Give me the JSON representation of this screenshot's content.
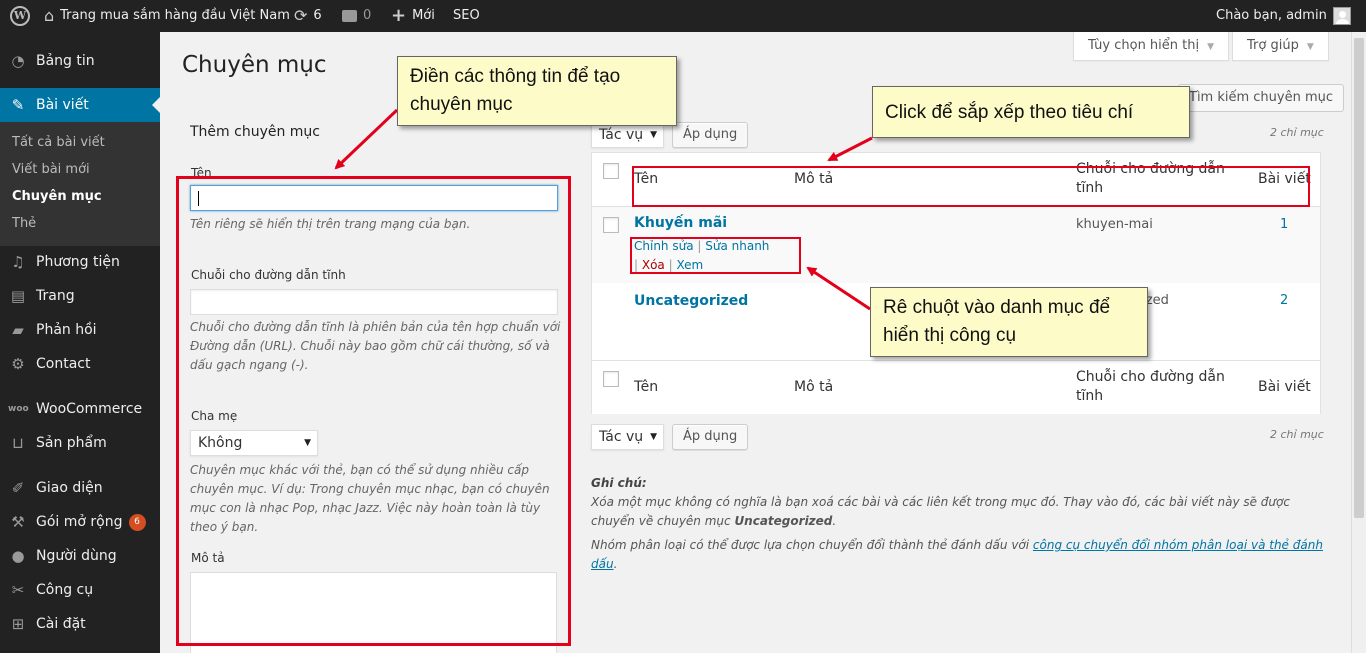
{
  "adminbar": {
    "site_name": "Trang mua sắm hàng đầu Việt Nam",
    "updates_count": "6",
    "comments_count": "0",
    "new_label": "Mới",
    "seo_label": "SEO",
    "greeting": "Chào bạn, admin"
  },
  "sidebar": {
    "dashboard": "Bảng tin",
    "posts": "Bài viết",
    "sub_all": "Tất cả bài viết",
    "sub_new": "Viết bài mới",
    "sub_categories": "Chuyên mục",
    "sub_tags": "Thẻ",
    "media": "Phương tiện",
    "pages": "Trang",
    "comments": "Phản hồi",
    "contact": "Contact",
    "woocommerce": "WooCommerce",
    "products": "Sản phẩm",
    "appearance": "Giao diện",
    "plugins": "Gói mở rộng",
    "plugins_badge": "6",
    "users": "Người dùng",
    "tools": "Công cụ",
    "settings": "Cài đặt"
  },
  "header": {
    "title": "Chuyên mục",
    "screen_options": "Tùy chọn hiển thị",
    "help": "Trợ giúp",
    "search_button": "Tìm kiếm chuyên mục"
  },
  "form": {
    "heading": "Thêm chuyên mục",
    "name_label": "Tên",
    "name_value": "",
    "name_help": "Tên riêng sẽ hiển thị trên trang mạng của bạn.",
    "slug_label": "Chuỗi cho đường dẫn tĩnh",
    "slug_value": "",
    "slug_help": "Chuỗi cho đường dẫn tĩnh là phiên bản của tên hợp chuẩn với Đường dẫn (URL). Chuỗi này bao gồm chữ cái thường, số và dấu gạch ngang (-).",
    "parent_label": "Cha mẹ",
    "parent_value": "Không",
    "parent_help": "Chuyên mục khác với thẻ, bạn có thể sử dụng nhiều cấp chuyên mục. Ví dụ: Trong chuyên mục nhạc, bạn có chuyên mục con là nhạc Pop, nhạc Jazz. Việc này hoàn toàn là tùy theo ý bạn.",
    "desc_label": "Mô tả"
  },
  "list": {
    "bulk_action": "Tác vụ",
    "apply": "Áp dụng",
    "count": "2 chỉ mục",
    "columns": [
      "Tên",
      "Mô tả",
      "Chuỗi cho đường dẫn tĩnh",
      "Bài viết"
    ],
    "rows": [
      {
        "name": "Khuyến mãi",
        "slug": "khuyen-mai",
        "posts": "1"
      },
      {
        "name": "Uncategorized",
        "slug": "uncategorized",
        "posts": "2"
      }
    ],
    "actions": {
      "edit": "Chỉnh sửa",
      "quick_edit": "Sửa nhanh",
      "delete": "Xóa",
      "view": "Xem"
    }
  },
  "notes": {
    "title": "Ghi chú:",
    "line1_a": "Xóa một mục không có nghĩa là bạn xoá các bài và các liên kết trong mục đó. Thay vào đó, các bài viết này sẽ được chuyển về chuyên mục ",
    "line1_b": "Uncategorized",
    "line1_c": ".",
    "line2_a": "Nhóm phân loại có thể được lựa chọn chuyển đổi thành thẻ đánh dấu với ",
    "line2_link": "công cụ chuyển đổi nhóm phân loại và thẻ đánh dấu",
    "line2_c": "."
  },
  "annotations": {
    "fill_info": "Điền các thông tin để tạo chuyên mục",
    "click_sort": "Click để sắp xếp theo tiêu chí",
    "hover_tools": "Rê chuột vào danh mục để hiển thị công cụ"
  },
  "colors": {
    "accent": "#0074a2",
    "annotation_red": "#e3001b",
    "callout_bg": "#fdfcc8"
  }
}
